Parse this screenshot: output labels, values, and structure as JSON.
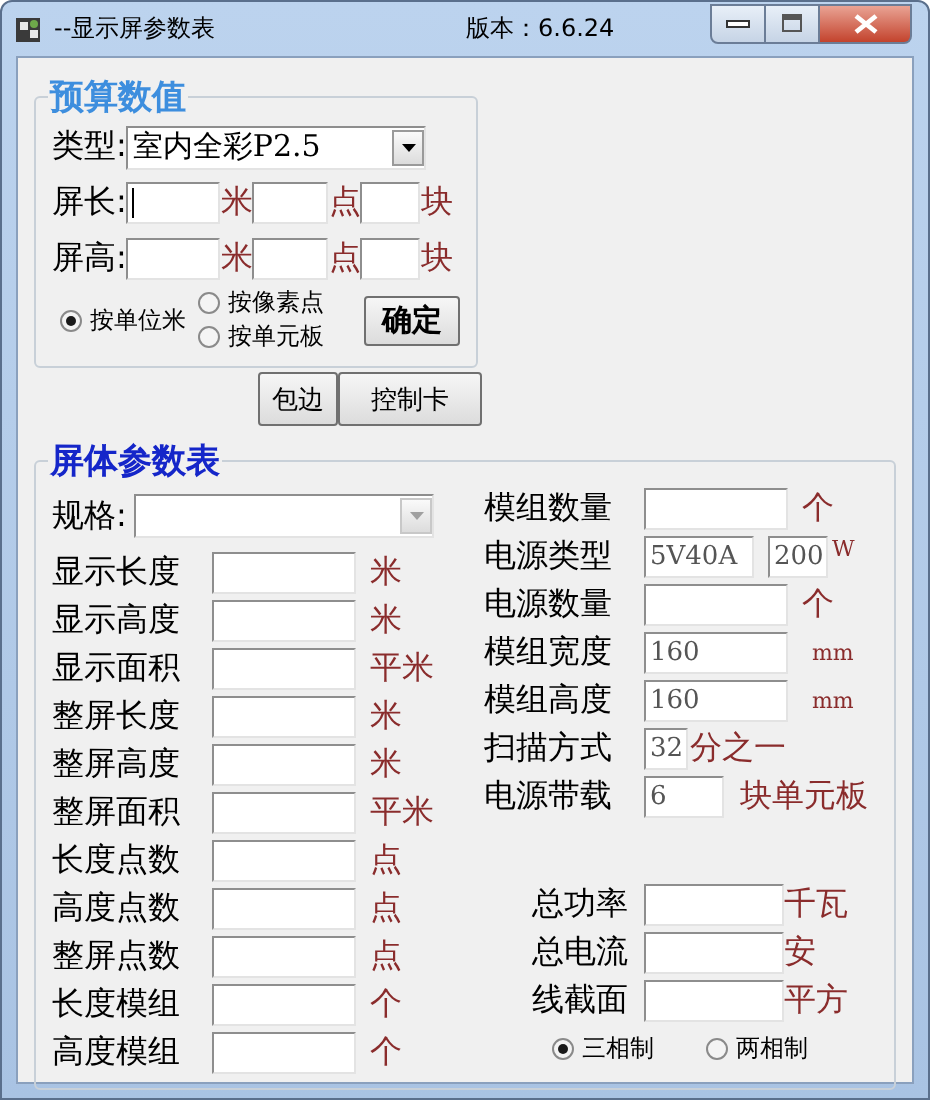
{
  "window": {
    "title": "--显示屏参数表",
    "version": "版本：6.6.24"
  },
  "budget": {
    "title": "预算数值",
    "type": {
      "label": "类型:",
      "value": "室内全彩P2.5"
    },
    "rows": [
      {
        "label": "屏长:",
        "fields": [
          {
            "unit": "米",
            "focused": true
          },
          {
            "unit": "点",
            "focused": false
          },
          {
            "unit": "块",
            "focused": false
          }
        ]
      },
      {
        "label": "屏高:",
        "fields": [
          {
            "unit": "米",
            "focused": false
          },
          {
            "unit": "点",
            "focused": false
          },
          {
            "unit": "块",
            "focused": false
          }
        ]
      }
    ],
    "modes": [
      {
        "label": "按单位米",
        "selected": true
      },
      {
        "label": "按像素点",
        "selected": false
      },
      {
        "label": "按单元板",
        "selected": false
      }
    ],
    "confirm": "确定"
  },
  "actions": [
    "包边",
    "控制卡"
  ],
  "params": {
    "title": "屏体参数表",
    "spec": {
      "label": "规格:"
    },
    "left": [
      {
        "label": "显示长度",
        "unit": "米"
      },
      {
        "label": "显示高度",
        "unit": "米"
      },
      {
        "label": "显示面积",
        "unit": "平米"
      },
      {
        "label": "整屏长度",
        "unit": "米"
      },
      {
        "label": "整屏高度",
        "unit": "米"
      },
      {
        "label": "整屏面积",
        "unit": "平米"
      },
      {
        "label": "长度点数",
        "unit": "点"
      },
      {
        "label": "高度点数",
        "unit": "点"
      },
      {
        "label": "整屏点数",
        "unit": "点"
      },
      {
        "label": "长度模组",
        "unit": "个"
      },
      {
        "label": "高度模组",
        "unit": "个"
      }
    ],
    "right": [
      {
        "kind": "standard",
        "label": "模组数量",
        "unit": "个"
      },
      {
        "kind": "pair",
        "label": "电源类型",
        "values": [
          "5V40A",
          "200"
        ],
        "unit": "W"
      },
      {
        "kind": "standard",
        "label": "电源数量",
        "unit": "个"
      },
      {
        "kind": "standard",
        "label": "模组宽度",
        "value": "160",
        "unit": "mm"
      },
      {
        "kind": "standard",
        "label": "模组高度",
        "value": "160",
        "unit": "mm"
      },
      {
        "kind": "scan",
        "label": "扫描方式",
        "value": "32",
        "unit": "分之一"
      },
      {
        "kind": "load",
        "label": "电源带载",
        "value": "6",
        "unit": "块单元板"
      }
    ],
    "totals": [
      {
        "label": "总功率",
        "unit": "千瓦"
      },
      {
        "label": "总电流",
        "unit": "安"
      },
      {
        "label": "线截面",
        "unit": "平方"
      }
    ],
    "phases": [
      {
        "label": "三相制",
        "selected": true
      },
      {
        "label": "两相制",
        "selected": false
      }
    ]
  }
}
